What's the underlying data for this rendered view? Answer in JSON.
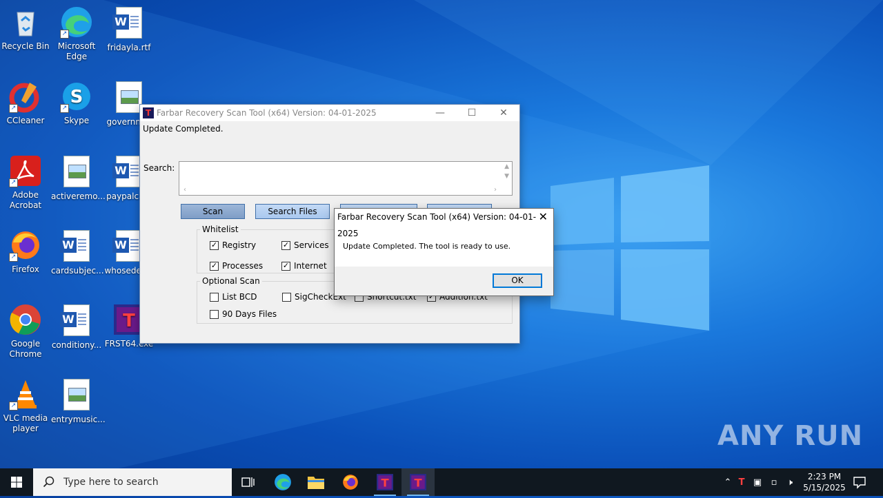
{
  "desktop": {
    "icons": [
      {
        "label": "Recycle Bin"
      },
      {
        "label": "Microsoft Edge"
      },
      {
        "label": "fridayla.rtf"
      },
      {
        "label": "CCleaner"
      },
      {
        "label": "Skype"
      },
      {
        "label": "governm..."
      },
      {
        "label": "Adobe Acrobat"
      },
      {
        "label": "activeremo..."
      },
      {
        "label": "paypalca..."
      },
      {
        "label": "Firefox"
      },
      {
        "label": "cardsubjec..."
      },
      {
        "label": "whosedev..."
      },
      {
        "label": "Google Chrome"
      },
      {
        "label": "conditiony..."
      },
      {
        "label": "FRST64.exe"
      },
      {
        "label": "VLC media player"
      },
      {
        "label": "entrymusic..."
      }
    ]
  },
  "frst_window": {
    "title": "Farbar Recovery Scan Tool (x64) Version: 04-01-2025",
    "status": "Update Completed.",
    "search_label": "Search:",
    "buttons": {
      "scan": "Scan",
      "search_files": "Search Files"
    },
    "whitelist": {
      "label": "Whitelist",
      "items": [
        {
          "label": "Registry",
          "checked": true
        },
        {
          "label": "Services",
          "checked": true
        },
        {
          "label": "Processes",
          "checked": true
        },
        {
          "label": "Internet",
          "checked": true
        }
      ]
    },
    "optional_scan": {
      "label": "Optional Scan",
      "items": [
        {
          "label": "List BCD",
          "checked": false
        },
        {
          "label": "SigCheckExt",
          "checked": false
        },
        {
          "label": "Shortcut.txt",
          "checked": false
        },
        {
          "label": "Addition.txt",
          "checked": true
        },
        {
          "label": "90 Days Files",
          "checked": false
        }
      ]
    }
  },
  "dialog": {
    "title": "Farbar Recovery Scan Tool (x64) Version: 04-01-2025",
    "message": "Update Completed. The tool is ready to use.",
    "ok": "OK"
  },
  "taskbar": {
    "search_placeholder": "Type here to search",
    "time": "2:23 PM",
    "date": "5/15/2025"
  },
  "watermark": "ANY RUN"
}
